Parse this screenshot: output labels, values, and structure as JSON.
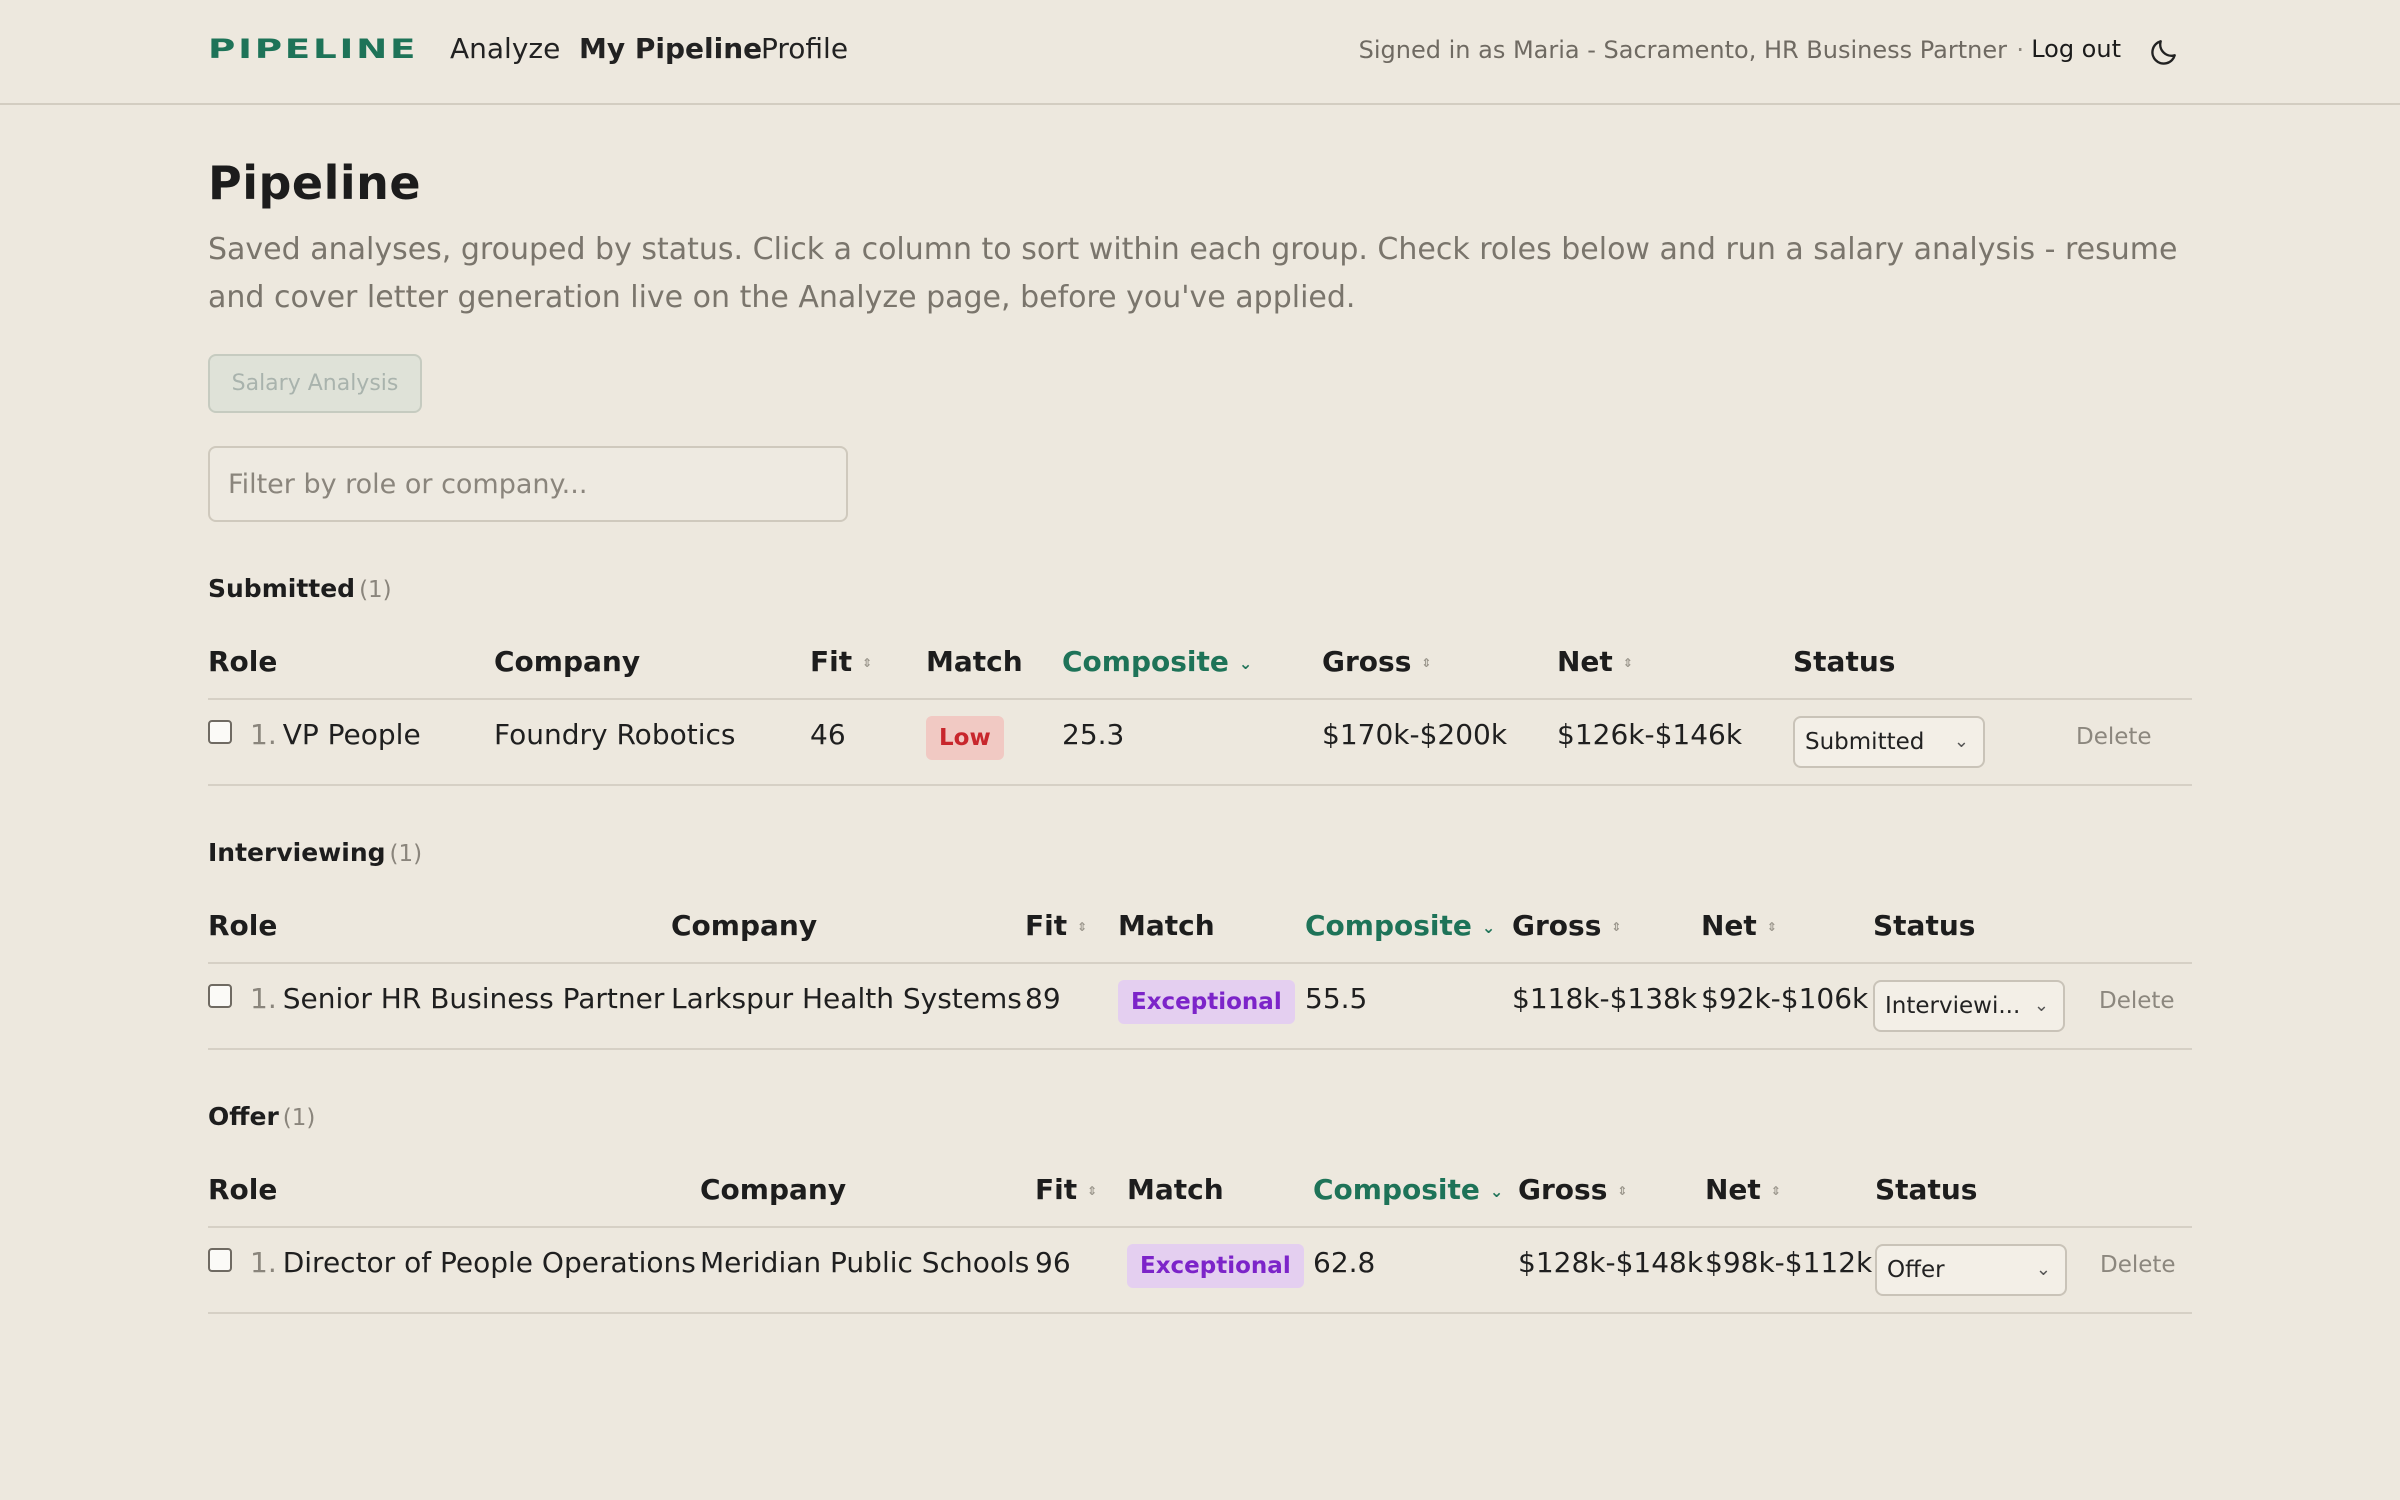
{
  "nav": {
    "logo": "PIPELINE",
    "links": [
      "Analyze",
      "My Pipeline",
      "Profile"
    ],
    "active": "My Pipeline",
    "signed_in": "Signed in as Maria - Sacramento, HR Business Partner",
    "separator": "·",
    "logout": "Log out",
    "theme_icon": "moon-icon"
  },
  "header": {
    "title": "Pipeline",
    "subtitle": "Saved analyses, grouped by status. Click a column to sort within each group. Check roles below and run a salary analysis - resume and cover letter generation live on the Analyze page, before you've applied.",
    "salary_button": "Salary Analysis",
    "filter_placeholder": "Filter by role or company..."
  },
  "columns": {
    "role": "Role",
    "company": "Company",
    "fit": "Fit",
    "match": "Match",
    "composite": "Composite",
    "gross": "Gross",
    "net": "Net",
    "status": "Status"
  },
  "groups": [
    {
      "name": "Submitted",
      "count": "(1)",
      "rows": [
        {
          "num": "1.",
          "role": "VP People",
          "company": "Foundry Robotics",
          "fit": "46",
          "match": "Low",
          "composite": "25.3",
          "gross": "$170k-$200k",
          "net": "$126k-$146k",
          "status": "Submitted",
          "delete": "Delete"
        }
      ]
    },
    {
      "name": "Interviewing",
      "count": "(1)",
      "rows": [
        {
          "num": "1.",
          "role": "Senior HR Business Partner",
          "company": "Larkspur Health Systems",
          "fit": "89",
          "match": "Exceptional",
          "composite": "55.5",
          "gross": "$118k-$138k",
          "net": "$92k-$106k",
          "status": "Interviewi...",
          "delete": "Delete"
        }
      ]
    },
    {
      "name": "Offer",
      "count": "(1)",
      "rows": [
        {
          "num": "1.",
          "role": "Director of People Operations",
          "company": "Meridian Public Schools",
          "fit": "96",
          "match": "Exceptional",
          "composite": "62.8",
          "gross": "$128k-$148k",
          "net": "$98k-$112k",
          "status": "Offer",
          "delete": "Delete"
        }
      ]
    }
  ],
  "colors": {
    "accent": "#1e7358",
    "background": "#ede8de",
    "low_badge_bg": "#f1c9c3",
    "low_badge_text": "#c8262c",
    "exceptional_badge_bg": "#e4cff0",
    "exceptional_badge_text": "#7c24c9"
  }
}
